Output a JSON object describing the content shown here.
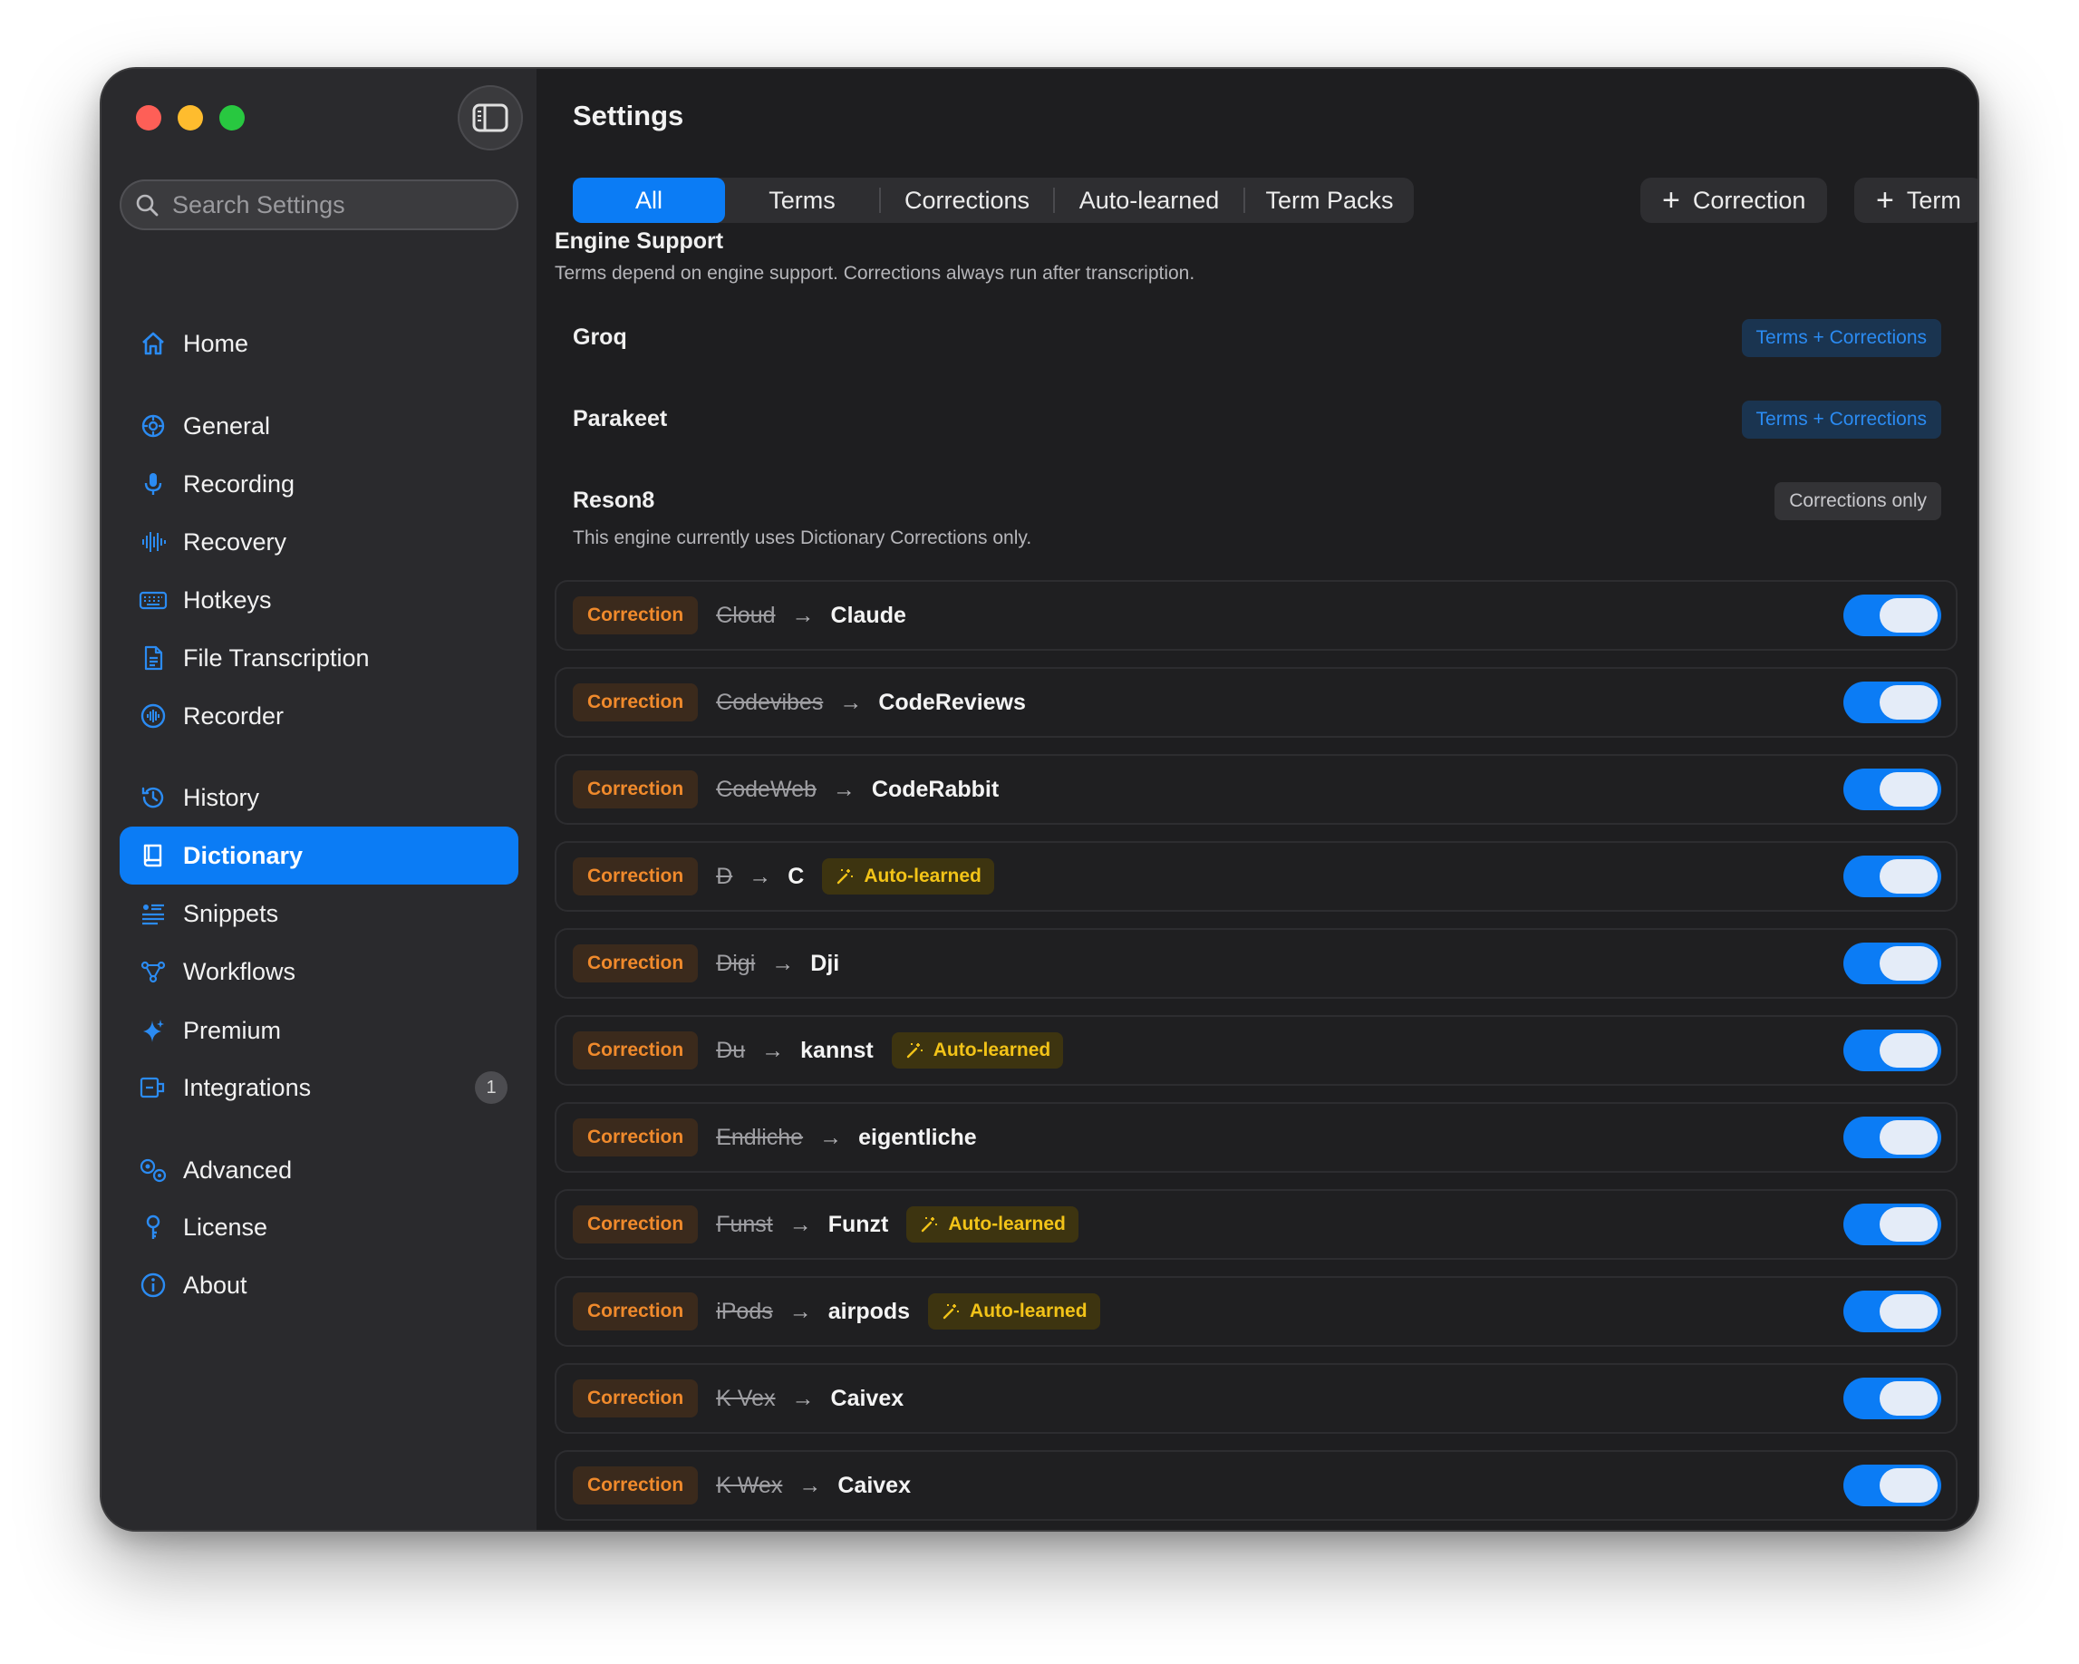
{
  "window": {
    "title": "Settings"
  },
  "search": {
    "placeholder": "Search Settings"
  },
  "sidebar": {
    "items": [
      {
        "label": "Home",
        "icon": "home-icon"
      },
      {
        "label": "General",
        "icon": "gear-icon"
      },
      {
        "label": "Recording",
        "icon": "microphone-icon"
      },
      {
        "label": "Recovery",
        "icon": "waveform-icon"
      },
      {
        "label": "Hotkeys",
        "icon": "keyboard-icon"
      },
      {
        "label": "File Transcription",
        "icon": "document-icon"
      },
      {
        "label": "Recorder",
        "icon": "record-icon"
      },
      {
        "label": "History",
        "icon": "history-icon"
      },
      {
        "label": "Dictionary",
        "icon": "book-icon",
        "active": true
      },
      {
        "label": "Snippets",
        "icon": "snippets-icon"
      },
      {
        "label": "Workflows",
        "icon": "workflow-icon"
      },
      {
        "label": "Premium",
        "icon": "sparkle-icon"
      },
      {
        "label": "Integrations",
        "icon": "integrations-icon",
        "badge": "1"
      },
      {
        "label": "Advanced",
        "icon": "gears-icon"
      },
      {
        "label": "License",
        "icon": "key-icon"
      },
      {
        "label": "About",
        "icon": "info-icon"
      }
    ]
  },
  "tabs": [
    "All",
    "Terms",
    "Corrections",
    "Auto-learned",
    "Term Packs"
  ],
  "actions": {
    "add_correction": "Correction",
    "add_term": "Term"
  },
  "engine_support": {
    "title": "Engine Support",
    "subtitle": "Terms depend on engine support. Corrections always run after transcription.",
    "engines": [
      {
        "name": "Groq",
        "badge": "Terms + Corrections",
        "badge_color": "#2b8bf2"
      },
      {
        "name": "Parakeet",
        "badge": "Terms + Corrections",
        "badge_color": "#2b8bf2"
      },
      {
        "name": "Reson8",
        "badge": "Corrections only",
        "badge_color": "#c8c8cc",
        "note": "This engine currently uses Dictionary Corrections only."
      }
    ]
  },
  "entries": [
    {
      "type": "Correction",
      "from": "Cloud",
      "to": "Claude",
      "auto": "",
      "enabled": true
    },
    {
      "type": "Correction",
      "from": "Codevibes",
      "to": "CodeReviews",
      "auto": "",
      "enabled": true
    },
    {
      "type": "Correction",
      "from": "CodeWeb",
      "to": "CodeRabbit",
      "auto": "",
      "enabled": true
    },
    {
      "type": "Correction",
      "from": "D",
      "to": "C",
      "auto": "Auto-learned",
      "enabled": true
    },
    {
      "type": "Correction",
      "from": "Digi",
      "to": "Dji",
      "auto": "",
      "enabled": true
    },
    {
      "type": "Correction",
      "from": "Du",
      "to": "kannst",
      "auto": "Auto-learned",
      "enabled": true
    },
    {
      "type": "Correction",
      "from": "Endliche",
      "to": "eigentliche",
      "auto": "",
      "enabled": true
    },
    {
      "type": "Correction",
      "from": "Funst",
      "to": "Funzt",
      "auto": "Auto-learned",
      "enabled": true
    },
    {
      "type": "Correction",
      "from": "iPods",
      "to": "airpods",
      "auto": "Auto-learned",
      "enabled": true
    },
    {
      "type": "Correction",
      "from": "K Vex",
      "to": "Caivex",
      "auto": "",
      "enabled": true
    },
    {
      "type": "Correction",
      "from": "K Wex",
      "to": "Caivex",
      "auto": "",
      "enabled": true
    }
  ],
  "colors": {
    "accent": "#0b7cf5",
    "correction": "#f08a2c",
    "auto_learned": "#f2c318"
  }
}
